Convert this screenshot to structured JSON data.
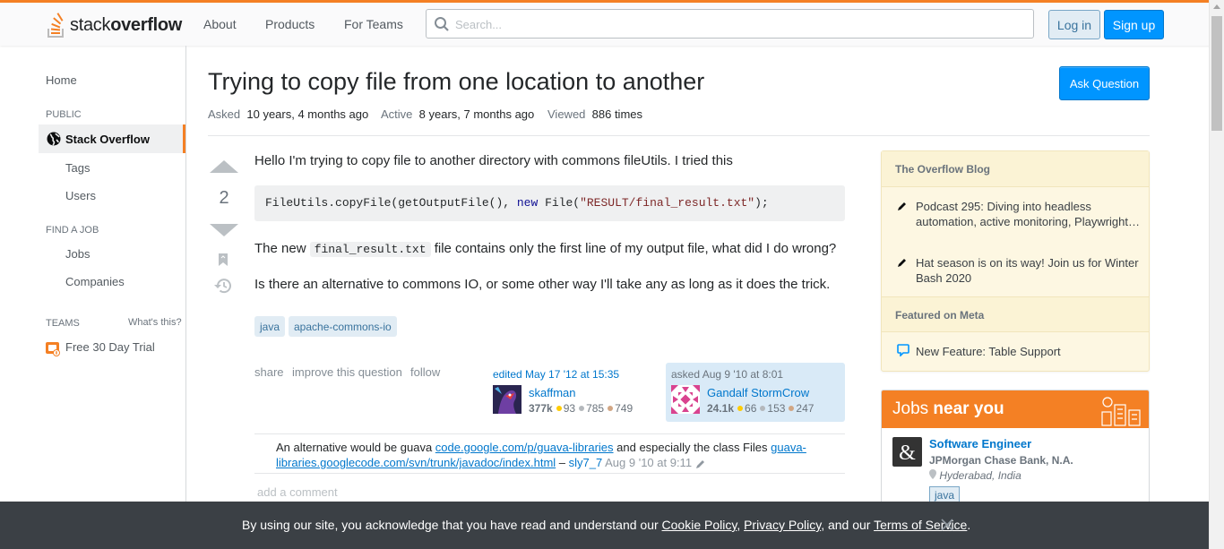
{
  "header": {
    "logo_light": "stack",
    "logo_bold": "overflow",
    "nav": [
      "About",
      "Products",
      "For Teams"
    ],
    "search_placeholder": "Search...",
    "login_label": "Log in",
    "signup_label": "Sign up"
  },
  "sidebar": {
    "home": "Home",
    "public_heading": "PUBLIC",
    "stack_overflow": "Stack Overflow",
    "tags": "Tags",
    "users": "Users",
    "find_job_heading": "FIND A JOB",
    "jobs": "Jobs",
    "companies": "Companies",
    "teams_heading": "TEAMS",
    "whats_this": "What's this?",
    "free_trial": "Free 30 Day Trial"
  },
  "question": {
    "title": "Trying to copy file from one location to another",
    "ask_button": "Ask Question",
    "asked_label": "Asked",
    "asked_value": "10 years, 4 months ago",
    "active_label": "Active",
    "active_value": "8 years, 7 months ago",
    "viewed_label": "Viewed",
    "viewed_value": "886 times",
    "vote_count": "2",
    "body_intro": "Hello I'm trying to copy file to another directory with commons fileUtils. I tried this",
    "code": {
      "part1": "FileUtils.copyFile(getOutputFile(), ",
      "kw": "new",
      "part2": " File(",
      "str": "\"RESULT/final_result.txt\"",
      "part3": ");"
    },
    "body_line2_pre": "The new ",
    "body_line2_code": "final_result.txt",
    "body_line2_post": " file contains only the first line of my output file, what did I do wrong?",
    "body_line3": "Is there an alternative to commons IO, or some other way I'll take any as long as it does the trick.",
    "tags": [
      "java",
      "apache-commons-io"
    ],
    "menu": [
      "share",
      "improve this question",
      "follow"
    ],
    "edited": {
      "when": "edited May 17 '12 at 15:35",
      "user": "skaffman",
      "rep": "377k",
      "gold": "93",
      "silver": "785",
      "bronze": "749"
    },
    "asked": {
      "when": "asked Aug 9 '10 at 8:01",
      "user": "Gandalf StormCrow",
      "rep": "24.1k",
      "gold": "66",
      "silver": "153",
      "bronze": "247"
    },
    "comment": {
      "text1": "An alternative would be guava ",
      "link1": "code.google.com/p/guava-libraries",
      "text2": " and especially the class Files ",
      "link2a": "guava-",
      "link2b": "libraries.googlecode.com/svn/trunk/javadoc/index.html",
      "sep": " – ",
      "user": "sly7_7",
      "date": "Aug 9 '10 at 9:11"
    },
    "add_comment": "add a comment"
  },
  "right_sidebar": {
    "blog_heading": "The Overflow Blog",
    "blog_items": [
      "Podcast 295: Diving into headless automation, active monitoring, Playwright…",
      "Hat season is on its way! Join us for Winter Bash 2020"
    ],
    "meta_heading": "Featured on Meta",
    "meta_items": [
      "New Feature: Table Support"
    ],
    "jobs_heading_light": "Jobs ",
    "jobs_heading_bold": "near you",
    "job": {
      "title": "Software Engineer",
      "company": "JPMorgan Chase Bank, N.A.",
      "location": "Hyderabad, India",
      "tag": "java"
    }
  },
  "cookie": {
    "text1": "By using our site, you acknowledge that you have read and understand our ",
    "cookie_policy": "Cookie Policy",
    "comma": ", ",
    "privacy_policy": "Privacy Policy",
    "and": ", and our ",
    "terms": "Terms of Service",
    "period": "."
  },
  "colors": {
    "brand_orange": "#f48024",
    "primary_blue": "#0095ff",
    "link_blue": "#0077cc"
  }
}
